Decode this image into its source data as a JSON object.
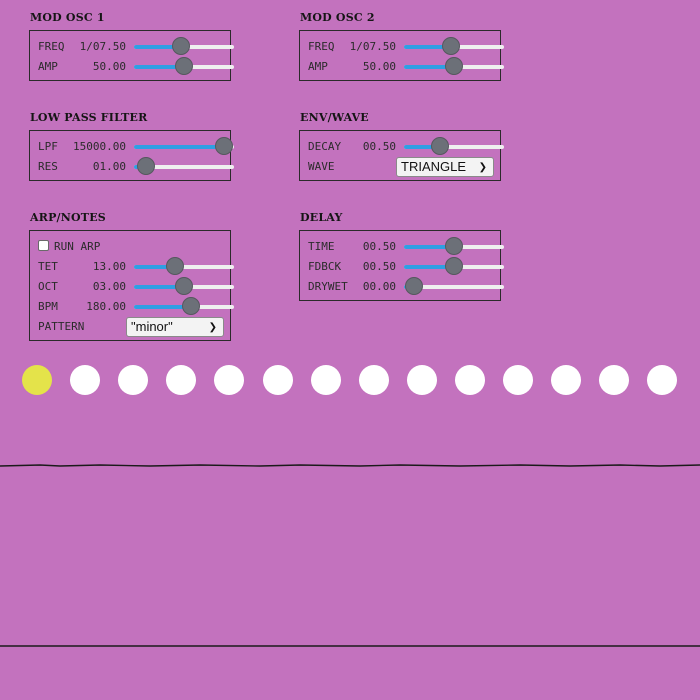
{
  "modosc1": {
    "title": "MOD OSC 1",
    "freq": {
      "label": "FREQ",
      "value": "1/07.50",
      "level": 0.47
    },
    "amp": {
      "label": "AMP",
      "value": "50.00",
      "level": 0.5
    }
  },
  "modosc2": {
    "title": "MOD OSC 2",
    "freq": {
      "label": "FREQ",
      "value": "1/07.50",
      "level": 0.47
    },
    "amp": {
      "label": "AMP",
      "value": "50.00",
      "level": 0.5
    }
  },
  "lpf": {
    "title": "LOW PASS FILTER",
    "cutoff": {
      "label": "LPF",
      "value": "15000.00",
      "level": 0.9
    },
    "res": {
      "label": "RES",
      "value": "01.00",
      "level": 0.12
    }
  },
  "envwave": {
    "title": "ENV/WAVE",
    "decay": {
      "label": "DECAY",
      "value": "00.50",
      "level": 0.36
    },
    "wave": {
      "label": "WAVE",
      "selected": "TRIANGLE"
    }
  },
  "arp": {
    "title": "ARP/NOTES",
    "run": {
      "label": "RUN ARP",
      "checked": false
    },
    "tet": {
      "label": "TET",
      "value": "13.00",
      "level": 0.41
    },
    "oct": {
      "label": "OCT",
      "value": "03.00",
      "level": 0.5
    },
    "bpm": {
      "label": "BPM",
      "value": "180.00",
      "level": 0.57
    },
    "pattern": {
      "label": "PATTERN",
      "selected": "\"minor\""
    }
  },
  "delay": {
    "title": "DELAY",
    "time": {
      "label": "TIME",
      "value": "00.50",
      "level": 0.5
    },
    "fdbck": {
      "label": "FDBCK",
      "value": "00.50",
      "level": 0.5
    },
    "drywet": {
      "label": "DRYWET",
      "value": "00.00",
      "level": 0.1
    }
  },
  "sequencer": {
    "steps": 14,
    "active_index": 0
  },
  "colors": {
    "background": "#c372be",
    "slider_fill": "#2e9fe3",
    "active_step": "#e4e34a",
    "step": "#ffffff"
  },
  "icons": {
    "dropdown": "chevron-down-icon"
  }
}
